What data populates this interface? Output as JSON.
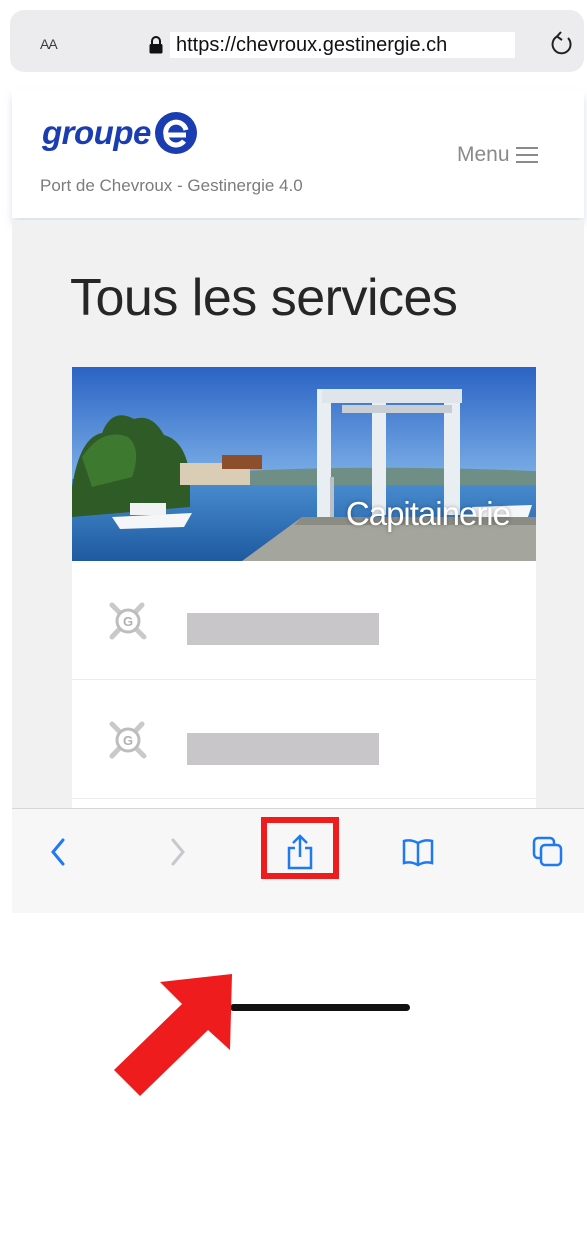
{
  "browser": {
    "text_size_label": "AA",
    "url": "https://chevroux.gestinergie.ch"
  },
  "header": {
    "logo_text": "groupe",
    "subtitle": "Port de Chevroux - Gestinergie 4.0",
    "menu_label": "Menu"
  },
  "main": {
    "title": "Tous les services",
    "hero_label": "Capitainerie"
  },
  "colors": {
    "brand_blue": "#1a3db1",
    "ios_blue": "#1e79f2",
    "annotation_red": "#ee1c1c"
  }
}
